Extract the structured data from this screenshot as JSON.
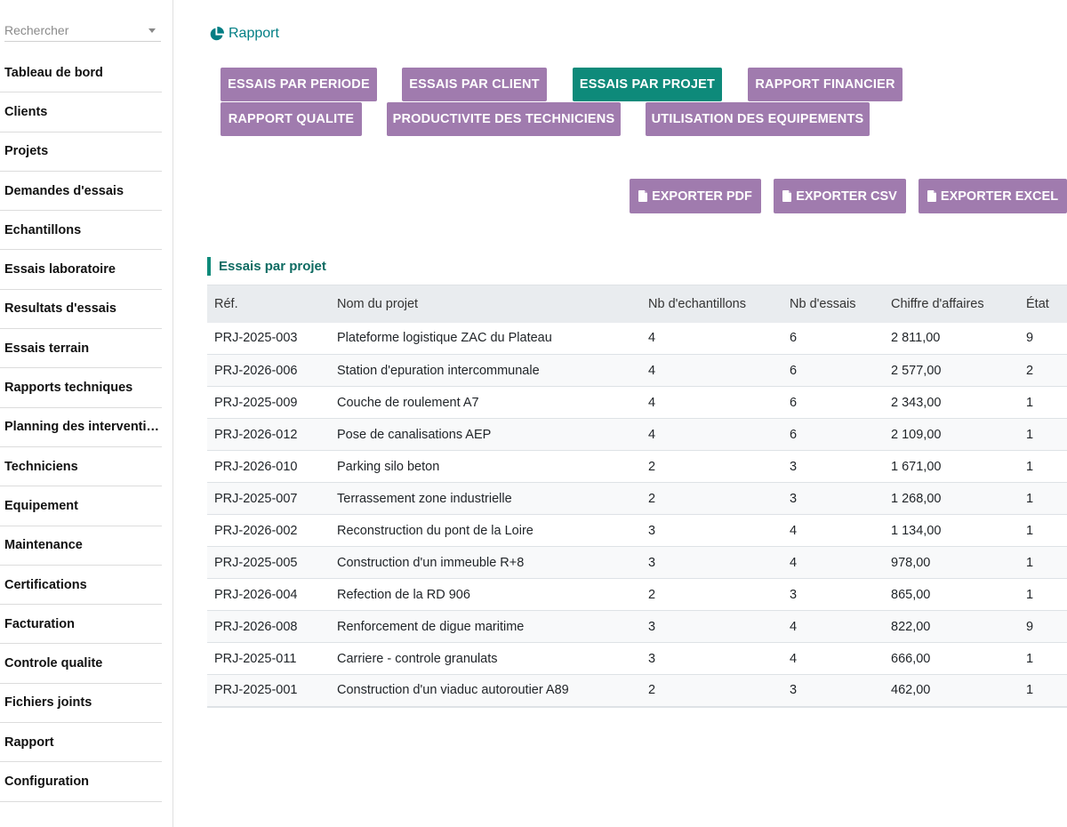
{
  "sidebar": {
    "search_placeholder": "Rechercher",
    "items": [
      {
        "label": "Tableau de bord"
      },
      {
        "label": "Clients"
      },
      {
        "label": "Projets"
      },
      {
        "label": "Demandes d'essais"
      },
      {
        "label": "Echantillons"
      },
      {
        "label": "Essais laboratoire"
      },
      {
        "label": "Resultats d'essais"
      },
      {
        "label": "Essais terrain"
      },
      {
        "label": "Rapports techniques"
      },
      {
        "label": "Planning des interventi…"
      },
      {
        "label": "Techniciens"
      },
      {
        "label": "Equipement"
      },
      {
        "label": "Maintenance"
      },
      {
        "label": "Certifications"
      },
      {
        "label": "Facturation"
      },
      {
        "label": "Controle qualite"
      },
      {
        "label": "Fichiers joints"
      },
      {
        "label": "Rapport"
      },
      {
        "label": "Configuration"
      }
    ]
  },
  "breadcrumb": {
    "label": "Rapport",
    "icon": "pie-chart-icon"
  },
  "report_buttons": [
    {
      "label": "ESSAIS PAR PERIODE",
      "active": false
    },
    {
      "label": "ESSAIS PAR CLIENT",
      "active": false
    },
    {
      "label": "ESSAIS PAR PROJET",
      "active": true
    },
    {
      "label": "RAPPORT FINANCIER",
      "active": false
    },
    {
      "label": "RAPPORT QUALITE",
      "active": false
    },
    {
      "label": "PRODUCTIVITE DES TECHNICIENS",
      "active": false
    },
    {
      "label": "UTILISATION DES EQUIPEMENTS",
      "active": false
    }
  ],
  "export_buttons": [
    {
      "label": "EXPORTER PDF",
      "icon": "file-pdf-icon"
    },
    {
      "label": "EXPORTER CSV",
      "icon": "file-csv-icon"
    },
    {
      "label": "EXPORTER EXCEL",
      "icon": "file-excel-icon"
    }
  ],
  "section_title": "Essais par projet",
  "table": {
    "headers": [
      "Réf.",
      "Nom du projet",
      "Nb d'echantillons",
      "Nb d'essais",
      "Chiffre d'affaires",
      "État"
    ],
    "rows": [
      [
        "PRJ-2025-003",
        "Plateforme logistique ZAC du Plateau",
        "4",
        "6",
        "2 811,00",
        "9"
      ],
      [
        "PRJ-2026-006",
        "Station d'epuration intercommunale",
        "4",
        "6",
        "2 577,00",
        "2"
      ],
      [
        "PRJ-2025-009",
        "Couche de roulement A7",
        "4",
        "6",
        "2 343,00",
        "1"
      ],
      [
        "PRJ-2026-012",
        "Pose de canalisations AEP",
        "4",
        "6",
        "2 109,00",
        "1"
      ],
      [
        "PRJ-2026-010",
        "Parking silo beton",
        "2",
        "3",
        "1 671,00",
        "1"
      ],
      [
        "PRJ-2025-007",
        "Terrassement zone industrielle",
        "2",
        "3",
        "1 268,00",
        "1"
      ],
      [
        "PRJ-2026-002",
        "Reconstruction du pont de la Loire",
        "3",
        "4",
        "1 134,00",
        "1"
      ],
      [
        "PRJ-2025-005",
        "Construction d'un immeuble R+8",
        "3",
        "4",
        "978,00",
        "1"
      ],
      [
        "PRJ-2026-004",
        "Refection de la RD 906",
        "2",
        "3",
        "865,00",
        "1"
      ],
      [
        "PRJ-2026-008",
        "Renforcement de digue maritime",
        "3",
        "4",
        "822,00",
        "9"
      ],
      [
        "PRJ-2025-011",
        "Carriere - controle granulats",
        "3",
        "4",
        "666,00",
        "1"
      ],
      [
        "PRJ-2025-001",
        "Construction d'un viaduc autoroutier A89",
        "2",
        "3",
        "462,00",
        "1"
      ]
    ]
  },
  "colors": {
    "button_purple": "#a07bae",
    "button_active": "#0e8a7a",
    "accent_teal": "#017e84"
  }
}
